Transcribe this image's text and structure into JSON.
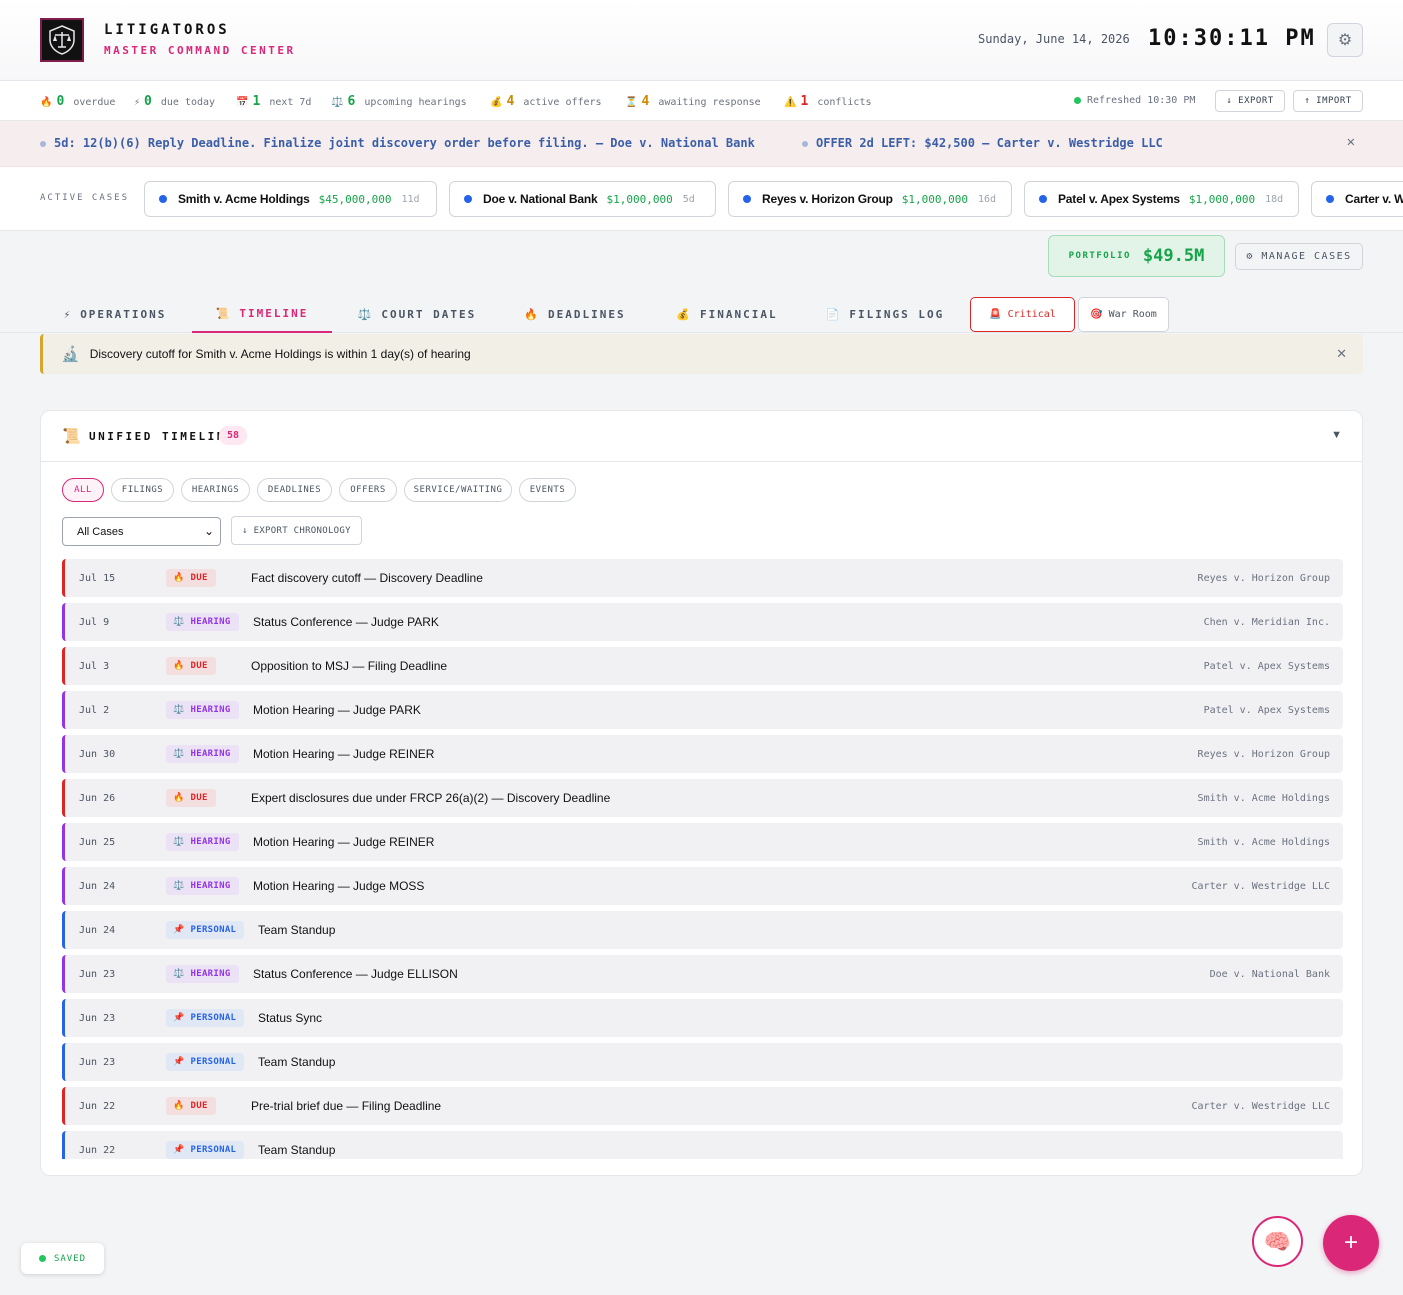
{
  "header": {
    "brand_name": "LITIGATOROS",
    "brand_sub": "MASTER COMMAND CENTER",
    "date": "Sunday, June 14, 2026",
    "time": "10:30:11 PM",
    "settings_icon": "gear-icon"
  },
  "stats": [
    {
      "icon": "🔥",
      "value": "0",
      "label": "overdue",
      "color": "#16a34a"
    },
    {
      "icon": "⚡",
      "value": "0",
      "label": "due today",
      "color": "#16a34a"
    },
    {
      "icon": "📅",
      "value": "1",
      "label": "next 7d",
      "color": "#16a34a"
    },
    {
      "icon": "⚖️",
      "value": "6",
      "label": "upcoming hearings",
      "color": "#16a34a"
    },
    {
      "icon": "💰",
      "value": "4",
      "label": "active offers",
      "color": "#ca8a04"
    },
    {
      "icon": "⏳",
      "value": "4",
      "label": "awaiting response",
      "color": "#ca8a04"
    },
    {
      "icon": "⚠️",
      "value": "1",
      "label": "conflicts",
      "color": "#dc2626"
    }
  ],
  "refresh": "Refreshed 10:30 PM",
  "export_label": "↓ EXPORT",
  "import_label": "↑ IMPORT",
  "ticker": {
    "item1": "5d: 12(b)(6) Reply Deadline. Finalize joint discovery order before filing. — Doe v. National Bank",
    "item2": "OFFER 2d LEFT: $42,500 — Carter v. Westridge LLC",
    "close": "✕"
  },
  "active_cases": {
    "label": "ACTIVE CASES",
    "items": [
      {
        "name": "Smith v. Acme Holdings",
        "amount": "$45,000,000",
        "days": "11d"
      },
      {
        "name": "Doe v. National Bank",
        "amount": "$1,000,000",
        "days": "5d"
      },
      {
        "name": "Reyes v. Horizon Group",
        "amount": "$1,000,000",
        "days": "16d"
      },
      {
        "name": "Patel v. Apex Systems",
        "amount": "$1,000,000",
        "days": "18d"
      },
      {
        "name": "Carter v. Westridge LLC",
        "amount": "",
        "days": ""
      }
    ]
  },
  "portfolio": {
    "label": "PORTFOLIO",
    "value": "$49.5M"
  },
  "manage_cases": "⚙ MANAGE CASES",
  "tabs": [
    {
      "icon": "⚡",
      "label": "OPERATIONS"
    },
    {
      "icon": "📜",
      "label": "TIMELINE"
    },
    {
      "icon": "⚖️",
      "label": "COURT DATES"
    },
    {
      "icon": "🔥",
      "label": "DEADLINES"
    },
    {
      "icon": "💰",
      "label": "FINANCIAL"
    },
    {
      "icon": "📄",
      "label": "FILINGS LOG"
    }
  ],
  "critical_label": "🚨 Critical",
  "warroom_label": "🎯 War Room",
  "alert": {
    "icon": "🔬",
    "text": "Discovery cutoff for Smith v. Acme Holdings is within 1 day(s) of hearing",
    "close": "✕"
  },
  "timeline": {
    "icon": "📜",
    "title": "UNIFIED TIMELINE",
    "count": "58",
    "toggle": "▼",
    "filters": [
      "ALL",
      "FILINGS",
      "HEARINGS",
      "DEADLINES",
      "OFFERS",
      "SERVICE/WAITING",
      "EVENTS"
    ],
    "case_select": "All Cases",
    "export_chronology": "↓ EXPORT CHRONOLOGY",
    "rows": [
      {
        "date": "Jul 15",
        "type": "due",
        "badge": "DUE",
        "title": "Fact discovery cutoff — Discovery Deadline",
        "case": "Reyes v. Horizon Group"
      },
      {
        "date": "Jul 9",
        "type": "hearing",
        "badge": "HEARING",
        "title": "Status Conference — Judge PARK",
        "case": "Chen v. Meridian Inc."
      },
      {
        "date": "Jul 3",
        "type": "due",
        "badge": "DUE",
        "title": "Opposition to MSJ — Filing Deadline",
        "case": "Patel v. Apex Systems"
      },
      {
        "date": "Jul 2",
        "type": "hearing",
        "badge": "HEARING",
        "title": "Motion Hearing — Judge PARK",
        "case": "Patel v. Apex Systems"
      },
      {
        "date": "Jun 30",
        "type": "hearing",
        "badge": "HEARING",
        "title": "Motion Hearing — Judge REINER",
        "case": "Reyes v. Horizon Group"
      },
      {
        "date": "Jun 26",
        "type": "due",
        "badge": "DUE",
        "title": "Expert disclosures due under FRCP 26(a)(2) — Discovery Deadline",
        "case": "Smith v. Acme Holdings"
      },
      {
        "date": "Jun 25",
        "type": "hearing",
        "badge": "HEARING",
        "title": "Motion Hearing — Judge REINER",
        "case": "Smith v. Acme Holdings"
      },
      {
        "date": "Jun 24",
        "type": "hearing",
        "badge": "HEARING",
        "title": "Motion Hearing — Judge MOSS",
        "case": "Carter v. Westridge LLC"
      },
      {
        "date": "Jun 24",
        "type": "personal",
        "badge": "PERSONAL",
        "title": "Team Standup",
        "case": ""
      },
      {
        "date": "Jun 23",
        "type": "hearing",
        "badge": "HEARING",
        "title": "Status Conference — Judge ELLISON",
        "case": "Doe v. National Bank"
      },
      {
        "date": "Jun 23",
        "type": "personal",
        "badge": "PERSONAL",
        "title": "Status Sync",
        "case": ""
      },
      {
        "date": "Jun 23",
        "type": "personal",
        "badge": "PERSONAL",
        "title": "Team Standup",
        "case": ""
      },
      {
        "date": "Jun 22",
        "type": "due",
        "badge": "DUE",
        "title": "Pre-trial brief due — Filing Deadline",
        "case": "Carter v. Westridge LLC"
      },
      {
        "date": "Jun 22",
        "type": "personal",
        "badge": "PERSONAL",
        "title": "Team Standup",
        "case": ""
      }
    ]
  },
  "saved_label": "SAVED",
  "brain_icon": "🧠",
  "fab_label": "+",
  "colors": {
    "accent": "#db2777",
    "success": "#16a34a",
    "due": "#dc2626",
    "hearing": "#9333ea",
    "personal": "#2563eb"
  }
}
